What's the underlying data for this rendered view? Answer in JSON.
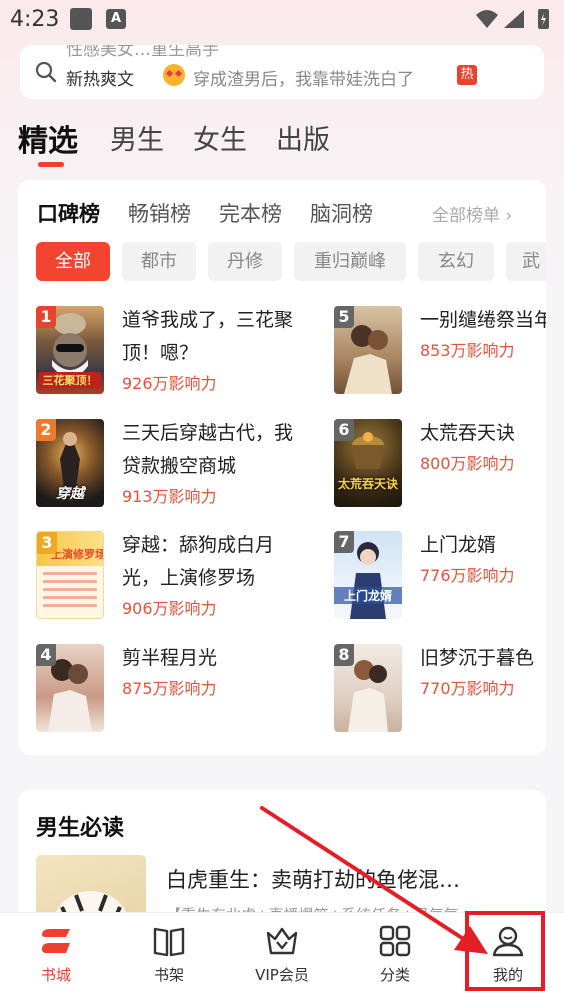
{
  "status_bar": {
    "time": "4:23",
    "icon_a": "A"
  },
  "search": {
    "ghost_text": "性感美女…重生高手",
    "prefix": "新热爽文",
    "text": "穿成渣男后，我靠带娃洗白了",
    "badge": "热"
  },
  "top_tabs": [
    "精选",
    "男生",
    "女生",
    "出版"
  ],
  "rank_tabs": [
    "口碑榜",
    "畅销榜",
    "完本榜",
    "脑洞榜"
  ],
  "all_ranks": "全部榜单 ›",
  "chips": [
    "全部",
    "都市",
    "丹修",
    "重归巅峰",
    "玄幻",
    "武"
  ],
  "books": [
    {
      "rank": "1",
      "title": "道爷我成了，三花聚顶！嗯？",
      "influence": "926万影响力"
    },
    {
      "rank": "2",
      "title": "三天后穿越古代，我贷款搬空商城",
      "influence": "913万影响力"
    },
    {
      "rank": "3",
      "title": "穿越：舔狗成白月光，上演修罗场",
      "influence": "906万影响力"
    },
    {
      "rank": "4",
      "title": "剪半程月光",
      "influence": "875万影响力"
    },
    {
      "rank": "5",
      "title": "一别缱绻祭当年",
      "influence": "853万影响力"
    },
    {
      "rank": "6",
      "title": "太荒吞天诀",
      "influence": "800万影响力"
    },
    {
      "rank": "7",
      "title": "上门龙婿",
      "influence": "776万影响力"
    },
    {
      "rank": "8",
      "title": "旧梦沉于暮色",
      "influence": "770万影响力"
    }
  ],
  "cover_text": {
    "book1": "三花聚顶！",
    "book2": "穿越",
    "book3": "上演修罗场",
    "book6": "太荒吞天诀",
    "book7": "上门龙婿"
  },
  "must_read": {
    "title": "男生必读",
    "book_title": "白虎重生：卖萌打劫的鱼佬混…",
    "book_desc": "【重生东北虎+直播爆笑+系统任务+灵气复…"
  },
  "nav": [
    {
      "label": "书城",
      "icon": "bookstore-icon"
    },
    {
      "label": "书架",
      "icon": "bookshelf-icon"
    },
    {
      "label": "VIP会员",
      "icon": "vip-crown-icon"
    },
    {
      "label": "分类",
      "icon": "category-grid-icon"
    },
    {
      "label": "我的",
      "icon": "profile-icon"
    }
  ],
  "colors": {
    "accent": "#ee3f2f",
    "influence": "#e5533c",
    "annotation": "#e41e26"
  }
}
